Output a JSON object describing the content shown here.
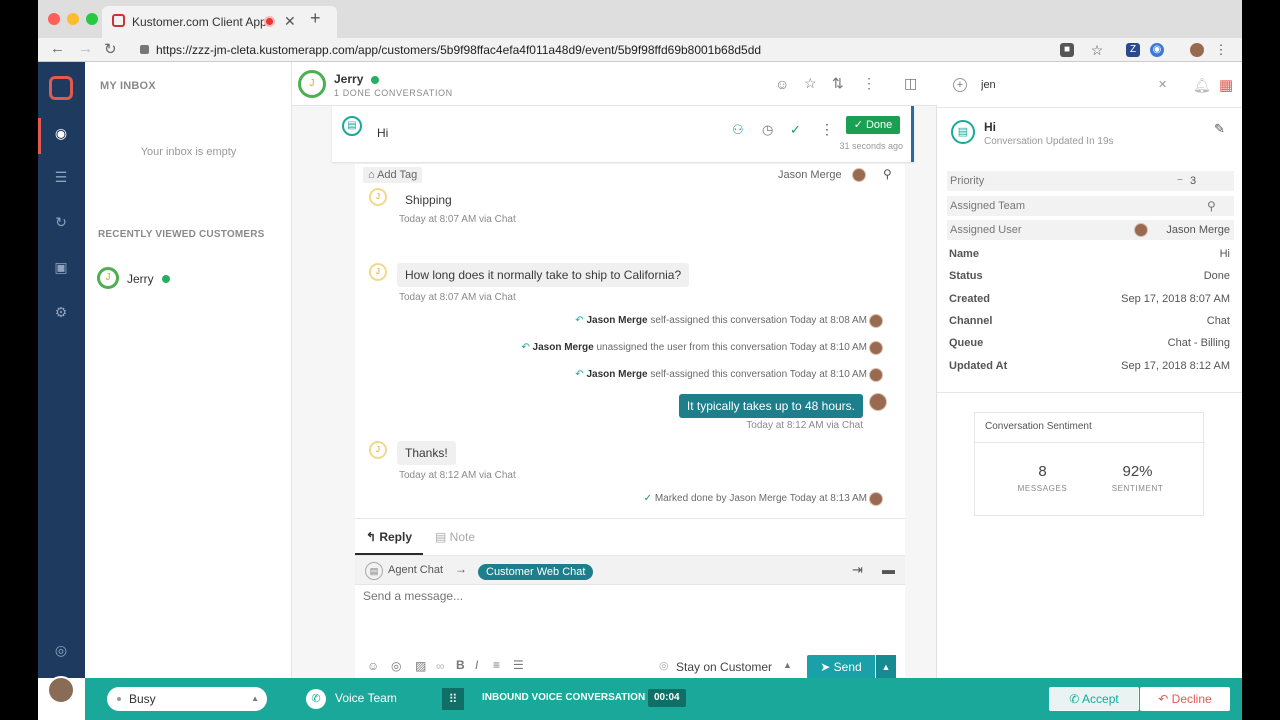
{
  "browser": {
    "tab_title": "Kustomer.com Client App",
    "url": "https://zzz-jm-cleta.kustomerapp.com/app/customers/5b9f98ffac4efa4f011a48d9/event/5b9f98ffd69b8001b68d5dd"
  },
  "inbox": {
    "title": "MY INBOX",
    "empty_text": "Your inbox is empty",
    "recent_heading": "RECENTLY VIEWED CUSTOMERS",
    "recent_customer": "Jerry"
  },
  "header": {
    "customer_name": "Jerry",
    "avatar_initial": "J",
    "subtitle": "1 DONE CONVERSATION"
  },
  "conversation": {
    "title": "Hi",
    "status": "Done",
    "time": "31 seconds ago",
    "add_tag": "Add Tag",
    "assignee": "Jason Merge"
  },
  "thread": {
    "m1_text": "Shipping",
    "m1_meta": "Today at 8:07 AM via Chat",
    "m2_text": "How long does it normally take to ship to California?",
    "m2_meta": "Today at 8:07 AM via Chat",
    "e1_name": "Jason Merge",
    "e1_text": "self-assigned this conversation Today at 8:08 AM",
    "e2_name": "Jason Merge",
    "e2_text": "unassigned the user from this conversation Today at 8:10 AM",
    "e3_name": "Jason Merge",
    "e3_text": "self-assigned this conversation Today at 8:10 AM",
    "agent_text": "It typically takes up to 48 hours.",
    "agent_meta": "Today at 8:12 AM via Chat",
    "m3_text": "Thanks!",
    "m3_meta": "Today at 8:12 AM via Chat",
    "done_text": "Marked done by Jason Merge Today at 8:13 AM"
  },
  "composer": {
    "reply_tab": "Reply",
    "note_tab": "Note",
    "from_channel": "Agent Chat",
    "to_channel": "Customer Web Chat",
    "placeholder": "Send a message...",
    "stay_label": "Stay on Customer",
    "send_label": "Send"
  },
  "details": {
    "search_value": "jen",
    "title": "Hi",
    "subtitle": "Conversation Updated In 19s",
    "priority_label": "Priority",
    "priority_value": "3",
    "team_label": "Assigned Team",
    "user_label": "Assigned User",
    "user_value": "Jason Merge",
    "fields": [
      {
        "label": "Name",
        "value": "Hi"
      },
      {
        "label": "Status",
        "value": "Done"
      },
      {
        "label": "Created",
        "value": "Sep 17, 2018 8:07 AM"
      },
      {
        "label": "Channel",
        "value": "Chat"
      },
      {
        "label": "Queue",
        "value": "Chat - Billing"
      },
      {
        "label": "Updated At",
        "value": "Sep 17, 2018 8:12 AM"
      }
    ],
    "sentiment_title": "Conversation Sentiment",
    "messages_value": "8",
    "messages_label": "MESSAGES",
    "sentiment_value": "92%",
    "sentiment_label": "SENTIMENT"
  },
  "footer": {
    "status": "Busy",
    "team": "Voice Team",
    "call_label": "INBOUND VOICE CONVERSATION",
    "timer": "00:04",
    "accept": "Accept",
    "decline": "Decline"
  },
  "colors": {
    "rail": "#1f3a5f",
    "accent": "#1aa89a",
    "done": "#1aa053",
    "brand": "#e05a4f"
  }
}
